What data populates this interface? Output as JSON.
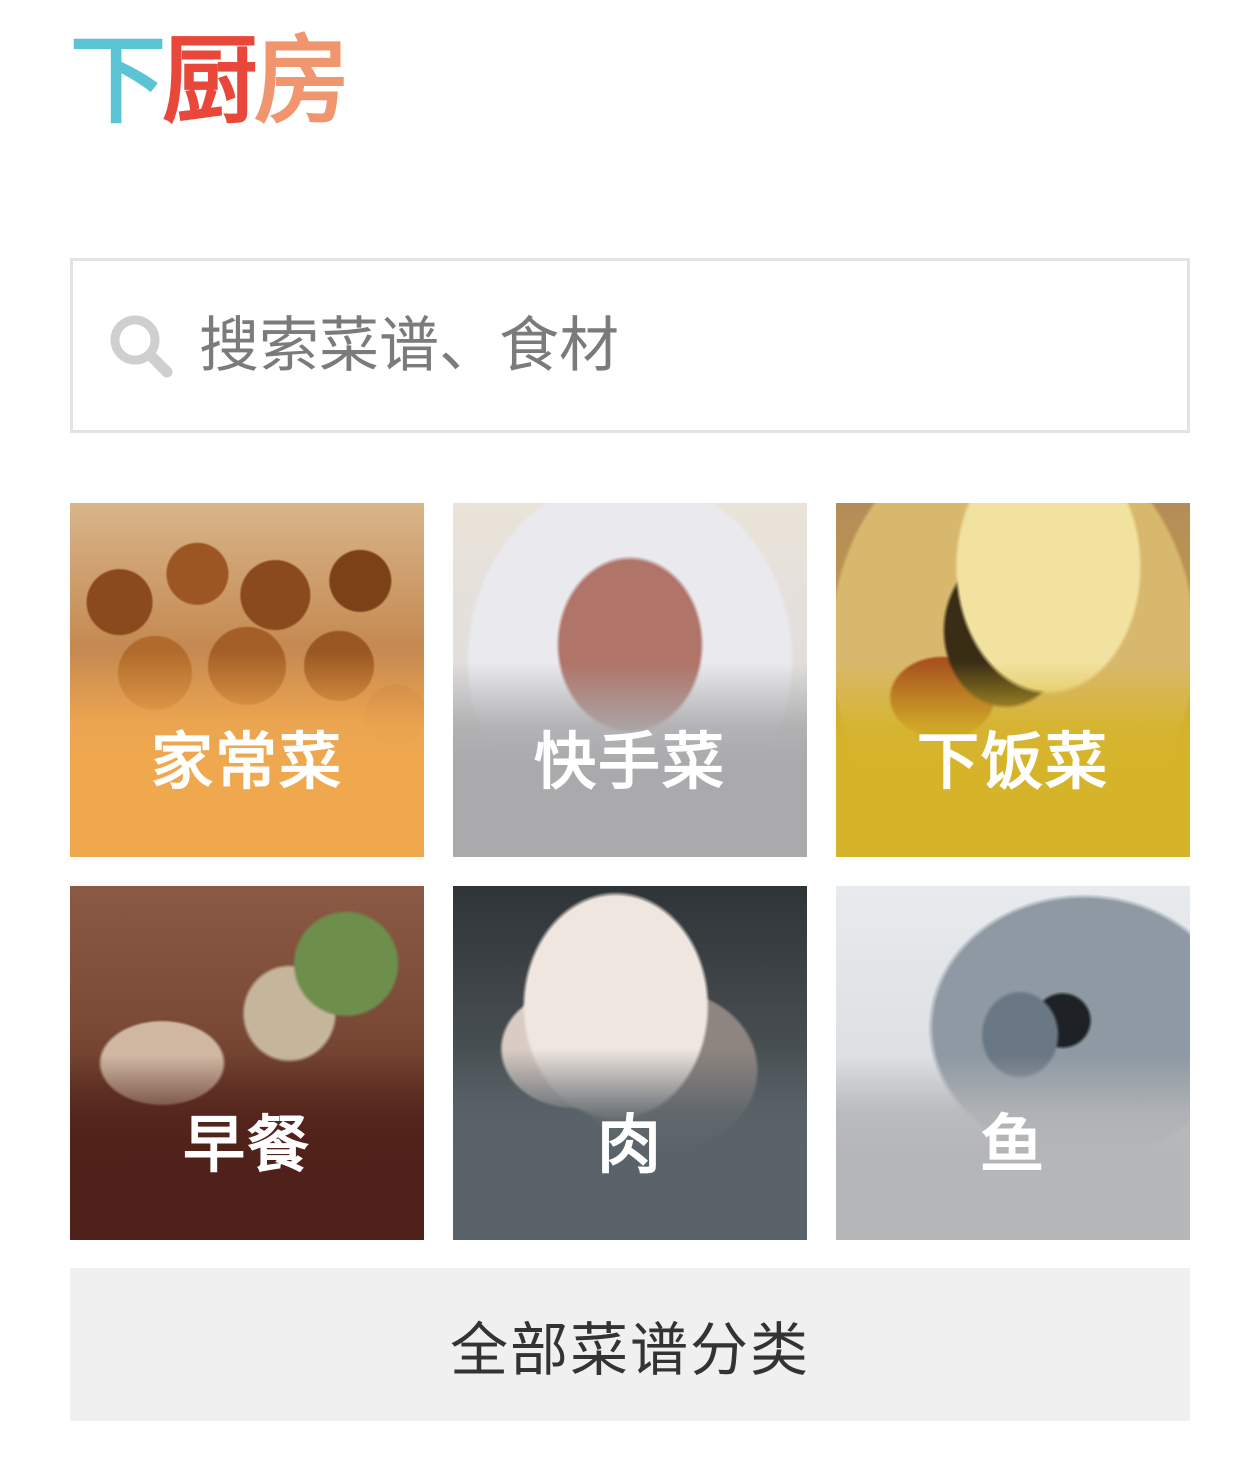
{
  "header": {
    "logo_chars": [
      "下",
      "厨",
      "房"
    ],
    "logo_colors": [
      "#5bc4d4",
      "#e8473a",
      "#f1956e"
    ]
  },
  "search": {
    "placeholder": "搜索菜谱、食材",
    "icon": "search-icon",
    "icon_color": "#cfcfcf"
  },
  "categories": [
    {
      "label": "家常菜",
      "color": "#f0a84f"
    },
    {
      "label": "快手菜",
      "color": "#aaaaac"
    },
    {
      "label": "下饭菜",
      "color": "#d6b42a"
    },
    {
      "label": "早餐",
      "color": "#4f211a"
    },
    {
      "label": "肉",
      "color": "#596369"
    },
    {
      "label": "鱼",
      "color": "#b5b6b8"
    }
  ],
  "all_categories_label": "全部菜谱分类"
}
